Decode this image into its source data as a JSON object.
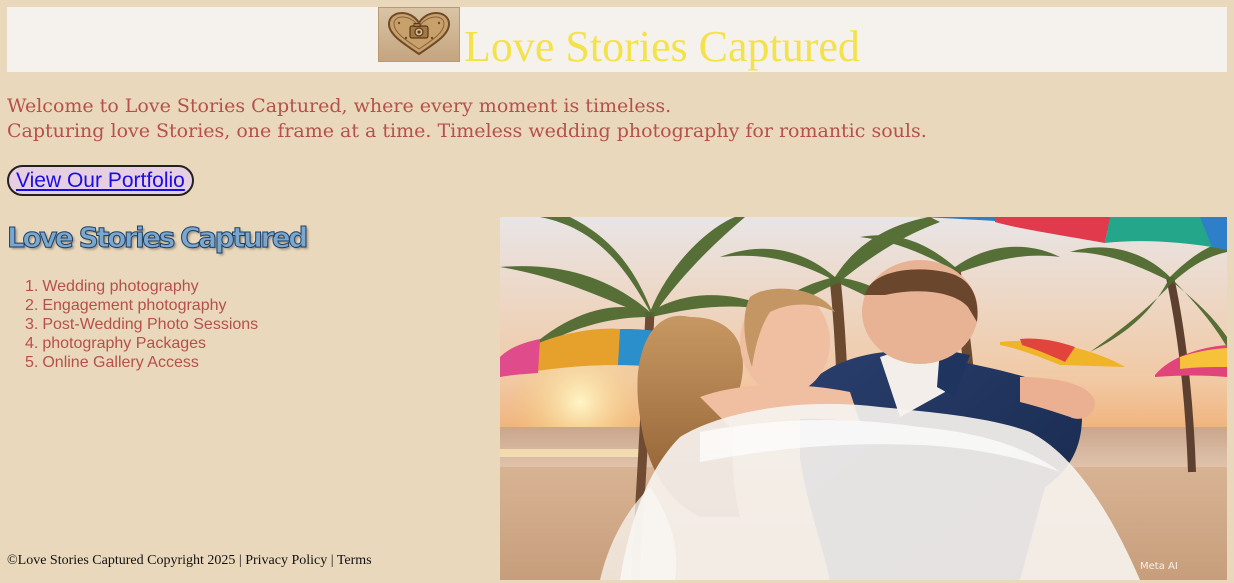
{
  "header": {
    "logo_icon": "heart-camera-logo-icon",
    "title": "Love Stories Captured",
    "title_color": "#f3e24a"
  },
  "intro": {
    "welcome": "Welcome to Love Stories Captured, where every moment is timeless.",
    "tagline": "Capturing love Stories, one frame at a time. Timeless wedding photography for romantic souls.",
    "text_color": "#b5504a"
  },
  "cta": {
    "portfolio_label": "View Our Portfolio"
  },
  "sidebar": {
    "heading": "Love Stories Captured",
    "services": [
      {
        "num": "1.",
        "label": "Wedding photography"
      },
      {
        "num": "2.",
        "label": "Engagement photography"
      },
      {
        "num": "3.",
        "label": "Post-Wedding Photo Sessions"
      },
      {
        "num": "4.",
        "label": "photography Packages"
      },
      {
        "num": "5.",
        "label": "Online Gallery Access"
      }
    ]
  },
  "footer": {
    "copyright": "©Love Stories Captured Copyright 2025",
    "separator": "|",
    "privacy": "Privacy Policy",
    "terms": "Terms"
  },
  "hero": {
    "watermark": "Meta AI"
  },
  "colors": {
    "page_bg": "#ead8bc",
    "header_bg": "#f5f2ee",
    "link": "#1a0ce6",
    "button_bg": "#e7cfe2"
  }
}
